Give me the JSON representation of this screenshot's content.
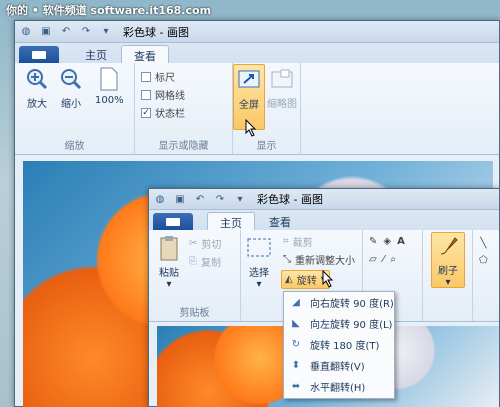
{
  "watermark": "你的 • 软件频道 software.it168.com",
  "win1": {
    "title": "彩色球 - 画图",
    "tabs": [
      "主页",
      "查看"
    ],
    "groups": {
      "zoom": {
        "label": "缩放",
        "zoom_in": "放大",
        "zoom_out": "缩小",
        "zoom_100": "100%"
      },
      "show_hide": {
        "label": "显示或隐藏",
        "ruler": "标尺",
        "gridlines": "网格线",
        "status_bar": "状态栏",
        "ruler_checked": false,
        "gridlines_checked": false,
        "status_bar_checked": true
      },
      "display": {
        "label": "显示",
        "fullscreen": "全屏",
        "thumbnail": "缩略图"
      }
    }
  },
  "win2": {
    "title": "彩色球 - 画图",
    "tabs": [
      "主页",
      "查看"
    ],
    "groups": {
      "clipboard": {
        "label": "剪贴板",
        "paste": "粘贴",
        "cut": "剪切",
        "copy": "复制"
      },
      "image": {
        "select": "选择",
        "crop": "裁剪",
        "resize": "重新调整大小",
        "rotate": "旋转"
      },
      "brushes": {
        "label": "刷子"
      }
    },
    "rotate_menu": [
      {
        "label": "向右旋转 90 度(R)",
        "icon": "rotate-right-icon"
      },
      {
        "label": "向左旋转 90 度(L)",
        "icon": "rotate-left-icon"
      },
      {
        "label": "旋转 180 度(T)",
        "icon": "rotate-180-icon"
      },
      {
        "label": "垂直翻转(V)",
        "icon": "flip-vertical-icon"
      },
      {
        "label": "水平翻转(H)",
        "icon": "flip-horizontal-icon"
      }
    ]
  }
}
